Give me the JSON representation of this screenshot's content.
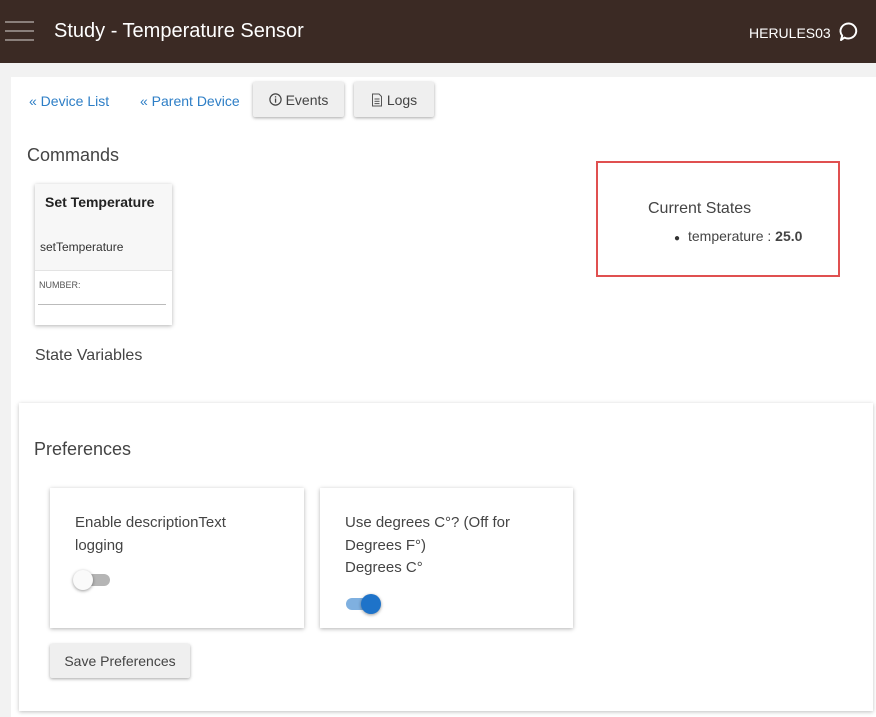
{
  "header": {
    "title": "Study - Temperature Sensor",
    "hub_name": "HERULES03"
  },
  "nav": {
    "device_list": "« Device List",
    "parent_device": "« Parent Device",
    "events": "Events",
    "logs": "Logs"
  },
  "commands": {
    "heading": "Commands",
    "items": [
      {
        "title": "Set Temperature",
        "name": "setTemperature",
        "field_label": "NUMBER:",
        "field_value": ""
      }
    ]
  },
  "state_variables": {
    "heading": "State Variables"
  },
  "current_states": {
    "heading": "Current States",
    "items": [
      {
        "key": "temperature",
        "separator": " : ",
        "value": "25.0"
      }
    ]
  },
  "preferences": {
    "heading": "Preferences",
    "items": [
      {
        "line1": "Enable descriptionText",
        "line2": "logging",
        "enabled": false
      },
      {
        "line1": "Use degrees C°? (Off for",
        "line2": "Degrees F°)",
        "line3": "Degrees C°",
        "enabled": true
      }
    ],
    "save_label": "Save Preferences"
  },
  "colors": {
    "topbar": "#3b2a24",
    "link": "#2d7ec6",
    "highlight_border": "#e05050",
    "toggle_on": "#1e73c9"
  }
}
